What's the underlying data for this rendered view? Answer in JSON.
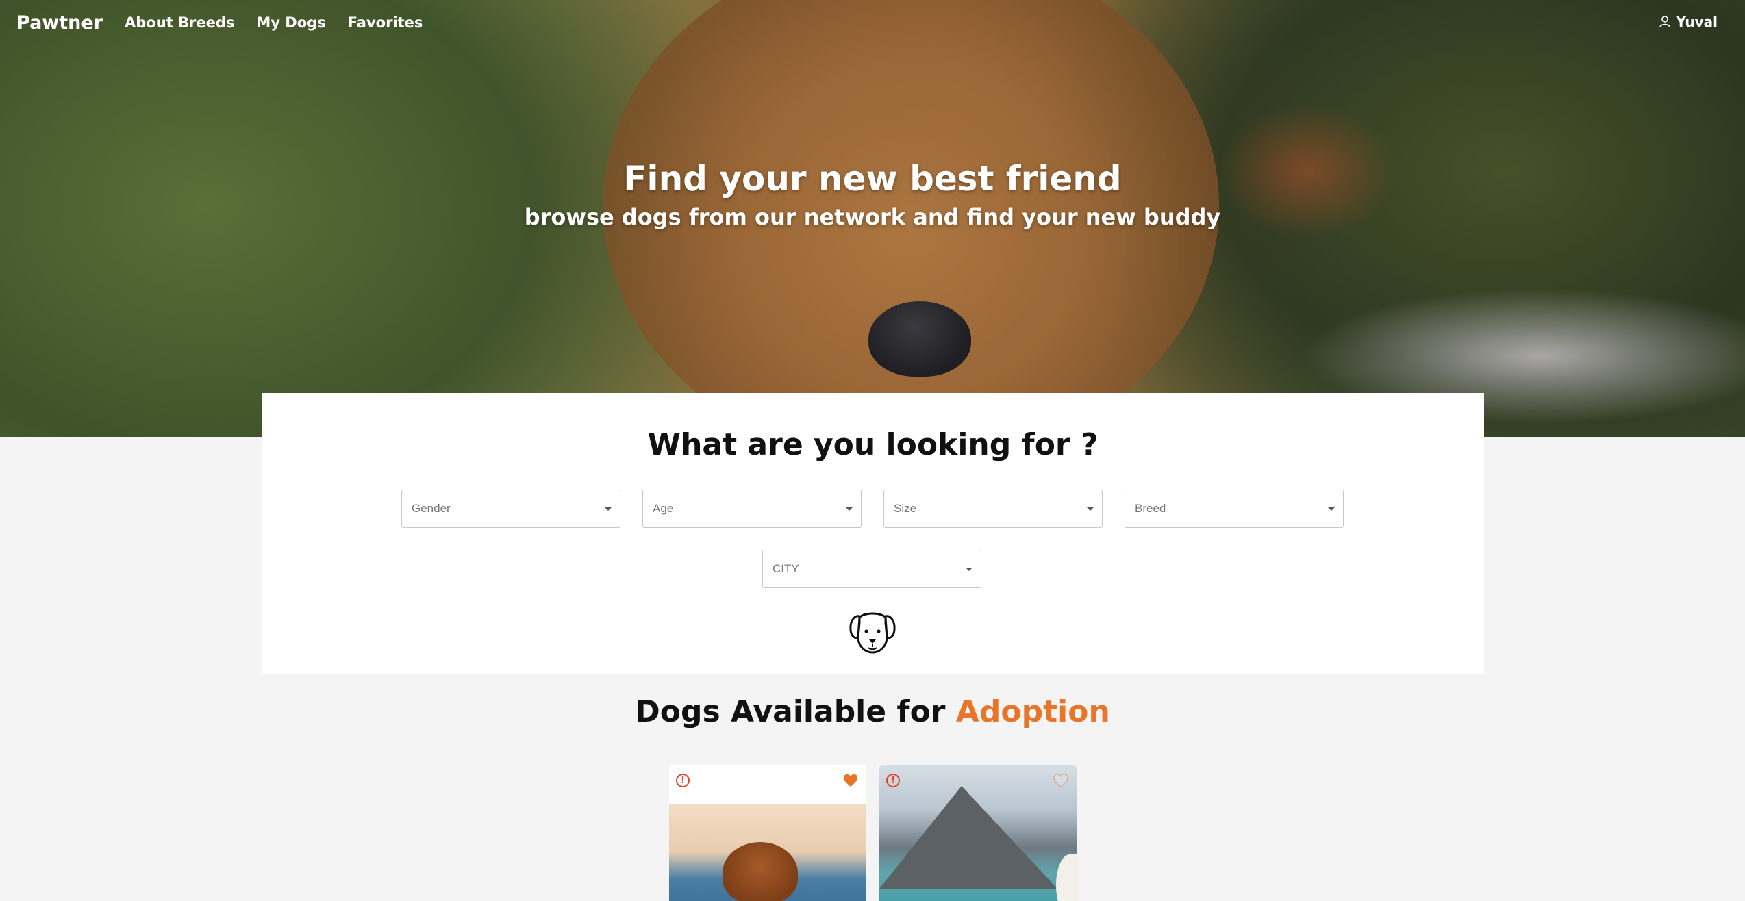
{
  "nav": {
    "brand": "Pawtner",
    "links": [
      "About Breeds",
      "My Dogs",
      "Favorites"
    ],
    "user": "Yuval"
  },
  "hero": {
    "title": "Find your new best friend",
    "subtitle": "browse dogs from our network and find your new buddy"
  },
  "search": {
    "title": "What are you looking for ?",
    "filters": [
      "Gender",
      "Age",
      "Size",
      "Breed"
    ],
    "city": "CITY"
  },
  "adoption": {
    "title_prefix": "Dogs Available for ",
    "title_accent": "Adoption"
  },
  "colors": {
    "accent": "#e8762a",
    "alert": "#e2492c"
  },
  "cards": [
    {
      "favorite": true,
      "alert_icon": "alert-circle-icon"
    },
    {
      "favorite": false,
      "alert_icon": "alert-circle-icon"
    }
  ]
}
